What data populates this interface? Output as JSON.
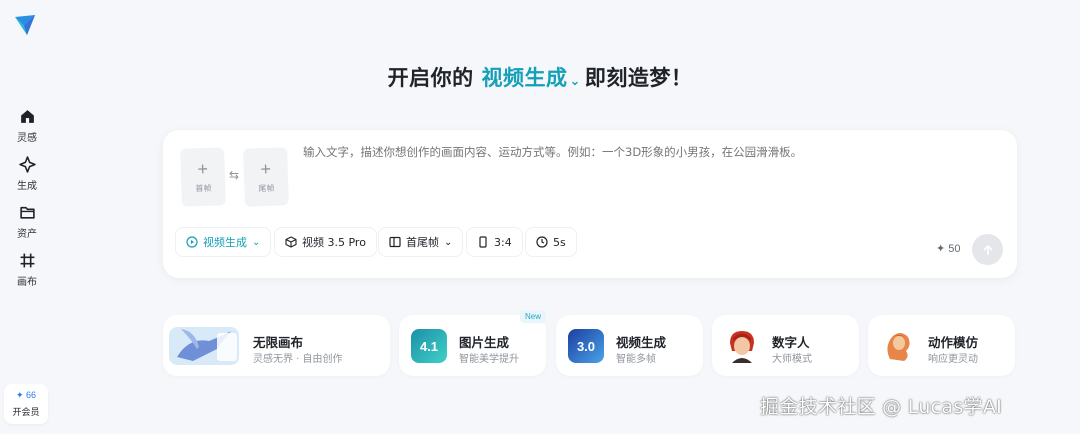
{
  "sidebar": {
    "items": [
      {
        "label": "灵感",
        "icon": "home-icon"
      },
      {
        "label": "生成",
        "icon": "sparkle-icon"
      },
      {
        "label": "资产",
        "icon": "folder-icon"
      },
      {
        "label": "画布",
        "icon": "canvas-icon"
      }
    ],
    "member": {
      "count": "✦ 66",
      "label": "开会员"
    }
  },
  "headline": {
    "prefix": "开启你的",
    "mode": "视频生成",
    "suffix": "即刻造梦！"
  },
  "composer": {
    "first_frame": "首帧",
    "last_frame": "尾帧",
    "placeholder": "输入文字，描述你想创作的画面内容、运动方式等。例如：一个3D形象的小男孩，在公园滑滑板。",
    "chips": {
      "mode": "视频生成",
      "model": "视频 3.5 Pro",
      "frames": "首尾帧",
      "ratio": "3:4",
      "duration": "5s"
    },
    "credits": "50",
    "accent": "#13a0b8"
  },
  "cards": [
    {
      "title": "无限画布",
      "sub": "灵感无界 · 自由创作"
    },
    {
      "title": "图片生成",
      "sub": "智能美学提升",
      "badge": "New",
      "thumb_text": "4.1"
    },
    {
      "title": "视频生成",
      "sub": "智能多帧",
      "thumb_text": "3.0"
    },
    {
      "title": "数字人",
      "sub": "大师模式"
    },
    {
      "title": "动作模仿",
      "sub": "响应更灵动"
    }
  ],
  "watermark": "掘金技术社区 @ Lucas学AI"
}
